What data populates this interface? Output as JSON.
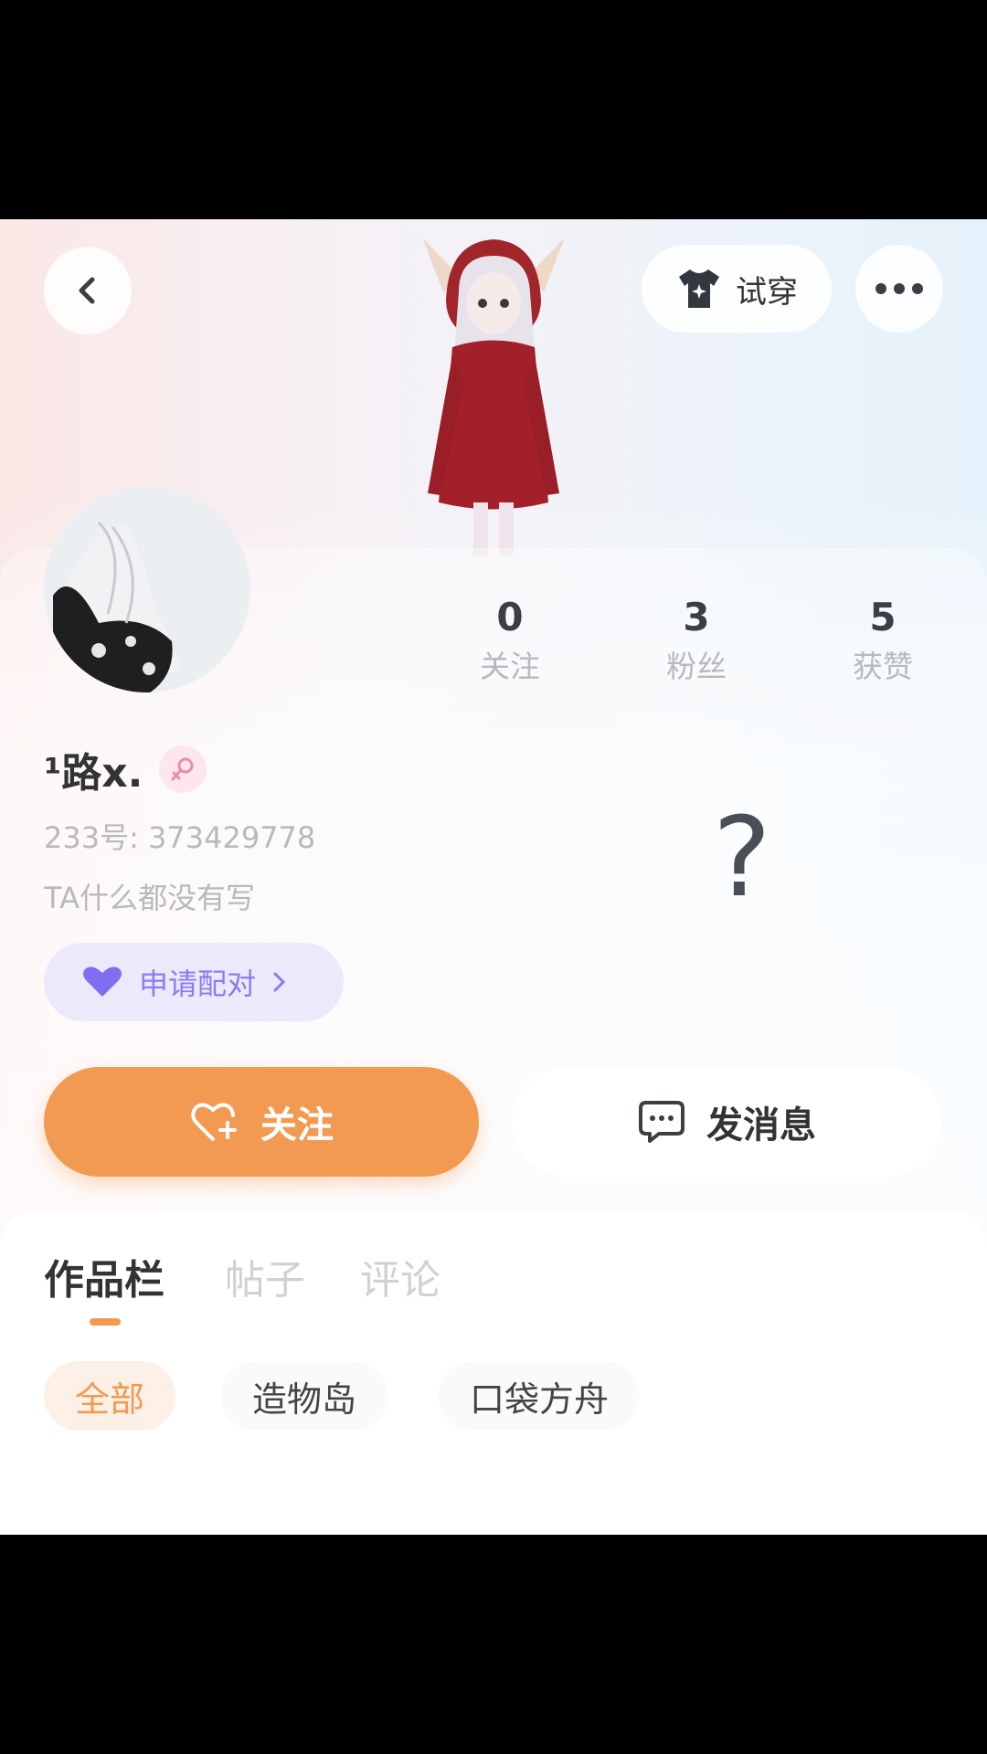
{
  "header": {
    "back_icon": "chevron-left-icon",
    "tryon_label": "试穿",
    "tryon_icon": "tshirt-icon",
    "more_icon": "more-dots-icon"
  },
  "stats": [
    {
      "value": "0",
      "label": "关注"
    },
    {
      "value": "3",
      "label": "粉丝"
    },
    {
      "value": "5",
      "label": "获赞"
    }
  ],
  "profile": {
    "username": "¹路x.",
    "gender_icon": "female-icon",
    "id_line": "233号:  373429778",
    "bio": "TA什么都没有写",
    "pair_label": "申请配对",
    "question_mark": "?"
  },
  "actions": {
    "follow_label": "关注",
    "message_label": "发消息"
  },
  "tabs": [
    {
      "label": "作品栏",
      "active": true
    },
    {
      "label": "帖子",
      "active": false
    },
    {
      "label": "评论",
      "active": false
    }
  ],
  "filters": [
    {
      "label": "全部",
      "active": true
    },
    {
      "label": "造物岛",
      "active": false
    },
    {
      "label": "口袋方舟",
      "active": false
    }
  ],
  "colors": {
    "accent": "#f39a52",
    "pair_accent": "#8a7cf0",
    "gender": "#f08aa6"
  }
}
